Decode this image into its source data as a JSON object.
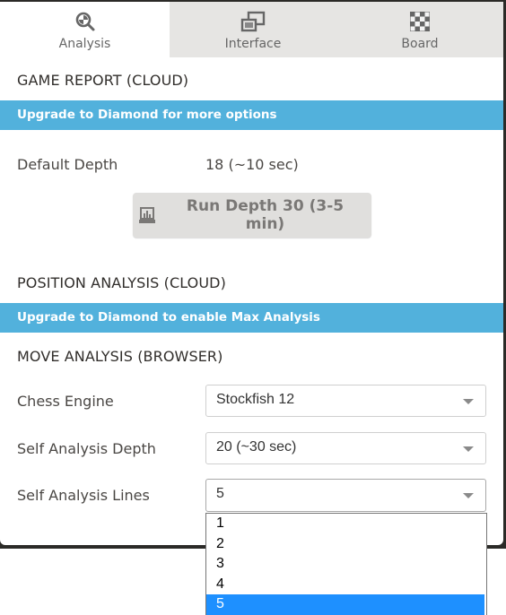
{
  "tabs": [
    {
      "label": "Analysis",
      "icon": "magnifier-analysis-icon",
      "active": true
    },
    {
      "label": "Interface",
      "icon": "windows-icon",
      "active": false
    },
    {
      "label": "Board",
      "icon": "checkerboard-icon",
      "active": false
    }
  ],
  "game_report": {
    "title": "GAME REPORT (CLOUD)",
    "banner": "Upgrade to Diamond for more options",
    "default_depth_label": "Default Depth",
    "default_depth_value": "18 (~10 sec)",
    "run_button_label": "Run Depth 30 (3-5 min)",
    "run_button_icon": "laptop-chart-icon"
  },
  "position_analysis": {
    "title": "POSITION ANALYSIS (CLOUD)",
    "banner": "Upgrade to Diamond to enable Max Analysis"
  },
  "move_analysis": {
    "title": "MOVE ANALYSIS (BROWSER)",
    "fields": [
      {
        "label": "Chess Engine",
        "value": "Stockfish 12"
      },
      {
        "label": "Self Analysis Depth",
        "value": "20 (~30 sec)"
      },
      {
        "label": "Self Analysis Lines",
        "value": "5"
      }
    ],
    "lines_options": [
      "1",
      "2",
      "3",
      "4",
      "5"
    ],
    "lines_selected": "5"
  },
  "colors": {
    "banner": "#52b1dc",
    "selected_option": "#1e90ff",
    "tab_inactive_bg": "#e6e5e3"
  }
}
